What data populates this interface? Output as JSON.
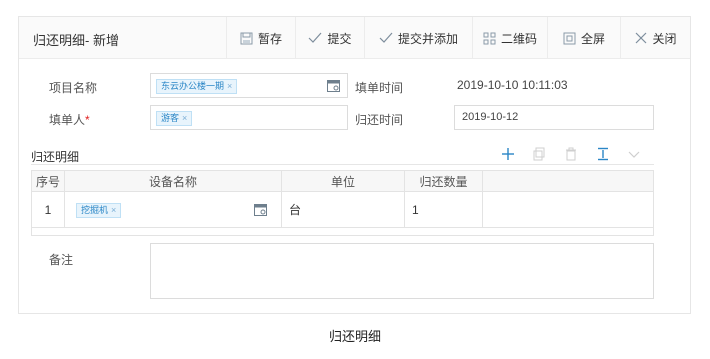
{
  "dialog": {
    "title": "归还明细- 新增",
    "toolbar": [
      {
        "label": "暂存",
        "icon": "save-icon"
      },
      {
        "label": "提交",
        "icon": "check-icon"
      },
      {
        "label": "提交并添加",
        "icon": "check-icon"
      },
      {
        "label": "二维码",
        "icon": "qrcode-icon"
      },
      {
        "label": "全屏",
        "icon": "fullscreen-icon"
      },
      {
        "label": "关闭",
        "icon": "close-icon"
      }
    ]
  },
  "form": {
    "project": {
      "label": "项目名称",
      "tag": "东云办公楼一期",
      "tag_remove": "×"
    },
    "bill_time": {
      "label": "填单时间",
      "value": "2019-10-10 10:11:03"
    },
    "filler": {
      "label": "填单人",
      "required_mark": "*",
      "tag": "游客",
      "tag_remove": "×"
    },
    "return_time": {
      "label": "归还时间",
      "value": "2019-10-12"
    },
    "remark": {
      "label": "备注",
      "value": ""
    }
  },
  "section": {
    "title": "归还明细",
    "actions": [
      "add-icon",
      "copy-icon",
      "delete-icon",
      "insert-icon",
      "chevron-down-icon"
    ]
  },
  "table": {
    "columns": [
      "序号",
      "设备名称",
      "单位",
      "归还数量"
    ],
    "rows": [
      {
        "index": "1",
        "device": "挖掘机",
        "device_remove": "×",
        "unit": "台",
        "qty": "1"
      }
    ]
  },
  "caption": "归还明细",
  "colors": {
    "accent": "#2a86c6",
    "tag_bg": "#e8f4fc",
    "border": "#dcdcdc"
  }
}
